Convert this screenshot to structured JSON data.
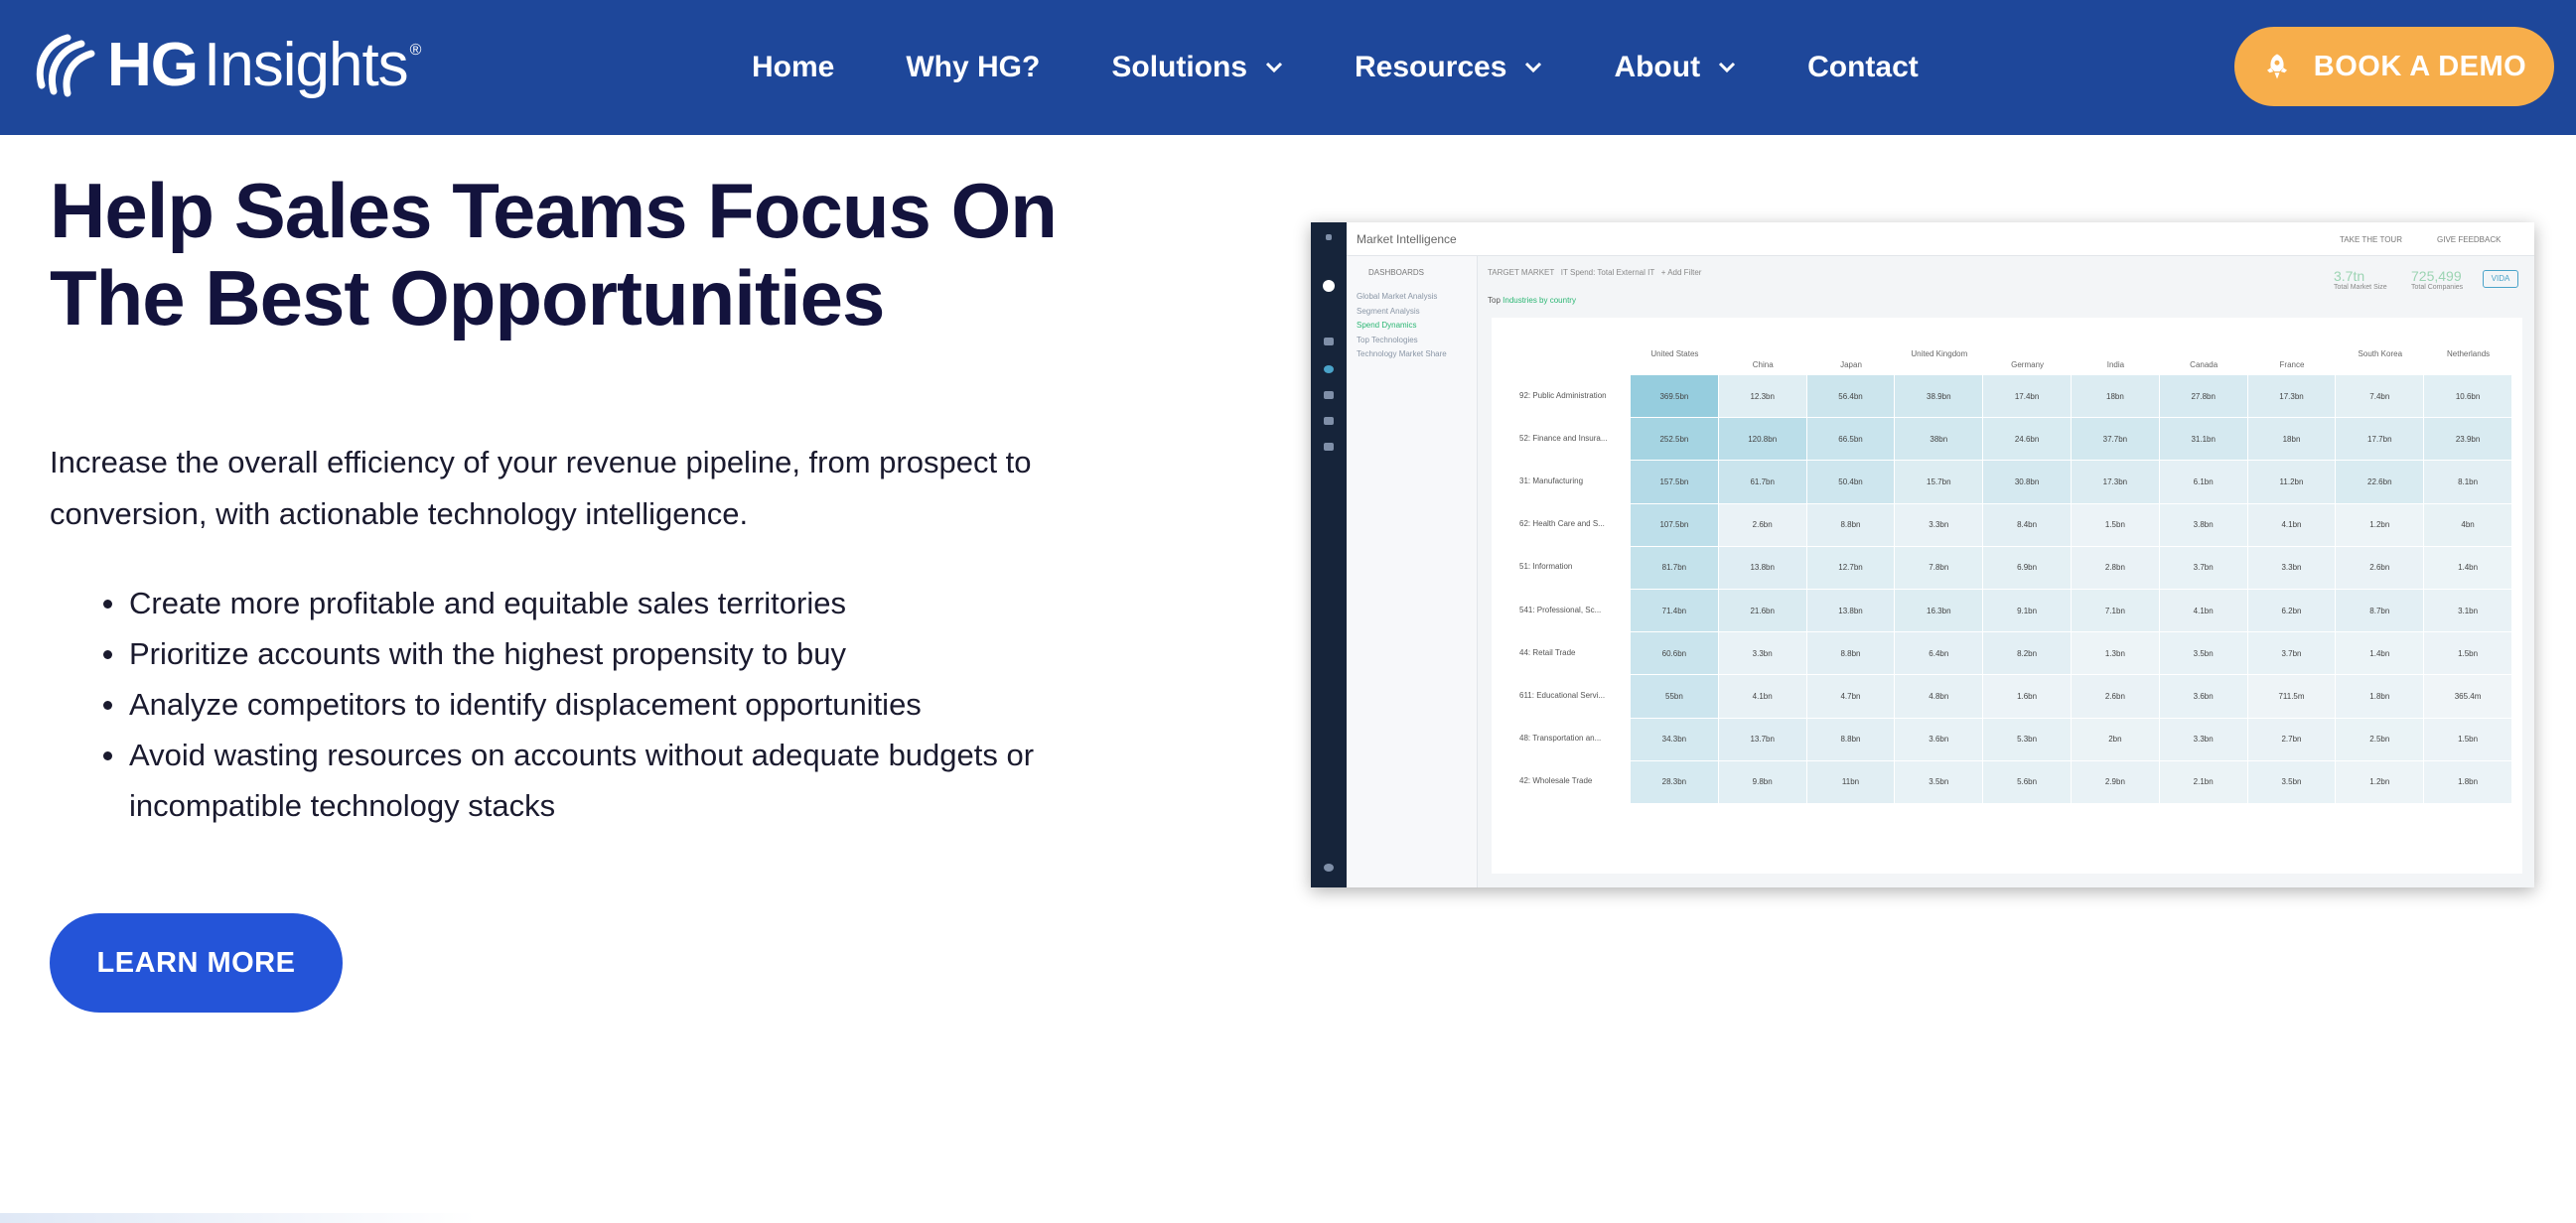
{
  "brand": {
    "bold": "HG",
    "light": "Insights",
    "reg": "®"
  },
  "nav": {
    "items": [
      {
        "label": "Home",
        "dd": false
      },
      {
        "label": "Why HG?",
        "dd": false
      },
      {
        "label": "Solutions",
        "dd": true
      },
      {
        "label": "Resources",
        "dd": true
      },
      {
        "label": "About",
        "dd": true
      },
      {
        "label": "Contact",
        "dd": false
      }
    ],
    "cta": "BOOK A DEMO"
  },
  "hero": {
    "title_line1": "Help Sales Teams Focus On",
    "title_line2": "The Best Opportunities",
    "lead": "Increase the overall efficiency of your revenue pipeline, from prospect to conversion, with actionable technology intelligence.",
    "bullets": [
      "Create more profitable and equitable sales territories",
      "Prioritize accounts with the highest propensity to buy",
      "Analyze competitors to identify displacement opportunities",
      "Avoid wasting resources on accounts without adequate budgets or incompatible technology stacks"
    ],
    "button": "LEARN MORE"
  },
  "dashboard": {
    "title": "Market Intelligence",
    "header_links": [
      "TAKE THE TOUR",
      "GIVE FEEDBACK"
    ],
    "side_header": "DASHBOARDS",
    "side_items": [
      "Global Market Analysis",
      "Segment Analysis",
      "Spend Dynamics",
      "Top Technologies",
      "Technology Market Share"
    ],
    "active_item": 2,
    "filter_label": "TARGET MARKET",
    "filter_value": "IT Spend: Total External IT",
    "add_filter": "+ Add Filter",
    "top_label": "Top",
    "top_value": "Industries by country",
    "stats": [
      {
        "value": "3.7tn",
        "label": "Total Market Size"
      },
      {
        "value": "725,499",
        "label": "Total Companies"
      }
    ],
    "vida": "VIDA",
    "columns": [
      "United States",
      "China",
      "Japan",
      "United Kingdom",
      "Germany",
      "India",
      "Canada",
      "France",
      "South Korea",
      "Netherlands"
    ],
    "rows": [
      {
        "label": "92: Public Administration",
        "values": [
          "369.5bn",
          "12.3bn",
          "56.4bn",
          "38.9bn",
          "17.4bn",
          "18bn",
          "27.8bn",
          "17.3bn",
          "7.4bn",
          "10.6bn"
        ]
      },
      {
        "label": "52: Finance and Insura...",
        "values": [
          "252.5bn",
          "120.8bn",
          "66.5bn",
          "38bn",
          "24.6bn",
          "37.7bn",
          "31.1bn",
          "18bn",
          "17.7bn",
          "23.9bn"
        ]
      },
      {
        "label": "31: Manufacturing",
        "values": [
          "157.5bn",
          "61.7bn",
          "50.4bn",
          "15.7bn",
          "30.8bn",
          "17.3bn",
          "6.1bn",
          "11.2bn",
          "22.6bn",
          "8.1bn"
        ]
      },
      {
        "label": "62: Health Care and S...",
        "values": [
          "107.5bn",
          "2.6bn",
          "8.8bn",
          "3.3bn",
          "8.4bn",
          "1.5bn",
          "3.8bn",
          "4.1bn",
          "1.2bn",
          "4bn"
        ]
      },
      {
        "label": "51: Information",
        "values": [
          "81.7bn",
          "13.8bn",
          "12.7bn",
          "7.8bn",
          "6.9bn",
          "2.8bn",
          "3.7bn",
          "3.3bn",
          "2.6bn",
          "1.4bn"
        ]
      },
      {
        "label": "541: Professional, Sc...",
        "values": [
          "71.4bn",
          "21.6bn",
          "13.8bn",
          "16.3bn",
          "9.1bn",
          "7.1bn",
          "4.1bn",
          "6.2bn",
          "8.7bn",
          "3.1bn"
        ]
      },
      {
        "label": "44: Retail Trade",
        "values": [
          "60.6bn",
          "3.3bn",
          "8.8bn",
          "6.4bn",
          "8.2bn",
          "1.3bn",
          "3.5bn",
          "3.7bn",
          "1.4bn",
          "1.5bn"
        ]
      },
      {
        "label": "611: Educational Servi...",
        "values": [
          "55bn",
          "4.1bn",
          "4.7bn",
          "4.8bn",
          "1.6bn",
          "2.6bn",
          "3.6bn",
          "711.5m",
          "1.8bn",
          "365.4m"
        ]
      },
      {
        "label": "48: Transportation an...",
        "values": [
          "34.3bn",
          "13.7bn",
          "8.8bn",
          "3.6bn",
          "5.3bn",
          "2bn",
          "3.3bn",
          "2.7bn",
          "2.5bn",
          "1.5bn"
        ]
      },
      {
        "label": "42: Wholesale Trade",
        "values": [
          "28.3bn",
          "9.8bn",
          "11bn",
          "3.5bn",
          "5.6bn",
          "2.9bn",
          "2.1bn",
          "3.5bn",
          "1.2bn",
          "1.8bn"
        ]
      }
    ]
  }
}
